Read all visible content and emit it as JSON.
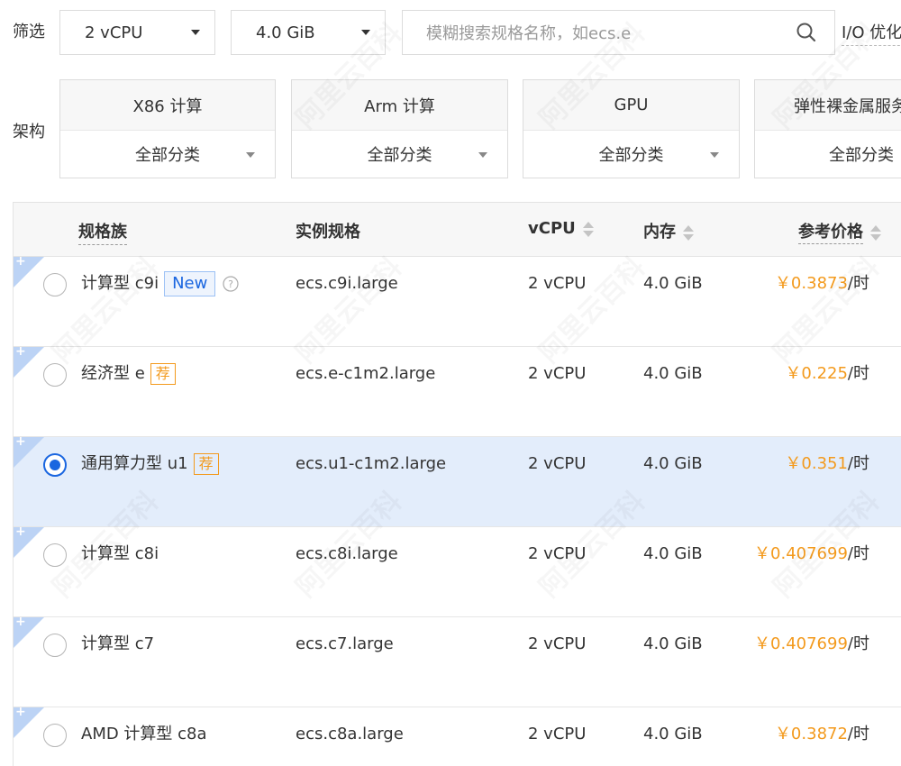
{
  "filters": {
    "label": "筛选",
    "cpu": "2 vCPU",
    "memory": "4.0 GiB",
    "search_placeholder": "模糊搜索规格名称，如ecs.e",
    "io_label": "I/O 优化"
  },
  "architecture": {
    "label": "架构",
    "cards": [
      {
        "title": "X86 计算",
        "category": "全部分类"
      },
      {
        "title": "Arm 计算",
        "category": "全部分类"
      },
      {
        "title": "GPU",
        "category": "全部分类"
      },
      {
        "title": "弹性裸金属服务",
        "category": "全部分类"
      }
    ]
  },
  "table": {
    "headers": {
      "family": "规格族",
      "spec": "实例规格",
      "vcpu": "vCPU",
      "memory": "内存",
      "price": "参考价格"
    },
    "rows": [
      {
        "family": "计算型 c9i",
        "badge": "New",
        "spec": "ecs.c9i.large",
        "vcpu": "2 vCPU",
        "memory": "4.0 GiB",
        "price": "￥0.3873",
        "unit": "/时"
      },
      {
        "family": "经济型 e",
        "badge": "荐",
        "spec": "ecs.e-c1m2.large",
        "vcpu": "2 vCPU",
        "memory": "4.0 GiB",
        "price": "￥0.225",
        "unit": "/时"
      },
      {
        "family": "通用算力型 u1",
        "badge": "荐",
        "spec": "ecs.u1-c1m2.large",
        "vcpu": "2 vCPU",
        "memory": "4.0 GiB",
        "price": "￥0.351",
        "unit": "/时"
      },
      {
        "family": "计算型 c8i",
        "spec": "ecs.c8i.large",
        "vcpu": "2 vCPU",
        "memory": "4.0 GiB",
        "price": "￥0.407699",
        "unit": "/时"
      },
      {
        "family": "计算型 c7",
        "spec": "ecs.c7.large",
        "vcpu": "2 vCPU",
        "memory": "4.0 GiB",
        "price": "￥0.407699",
        "unit": "/时"
      },
      {
        "family": "AMD 计算型 c8a",
        "spec": "ecs.c8a.large",
        "vcpu": "2 vCPU",
        "memory": "4.0 GiB",
        "price": "￥0.3872",
        "unit": "/时"
      }
    ],
    "selected_index": 2
  },
  "watermark": "阿里云百科",
  "colors": {
    "accent": "#1a66e0",
    "price": "#f39a1d",
    "selected_row": "#e3edfb"
  }
}
